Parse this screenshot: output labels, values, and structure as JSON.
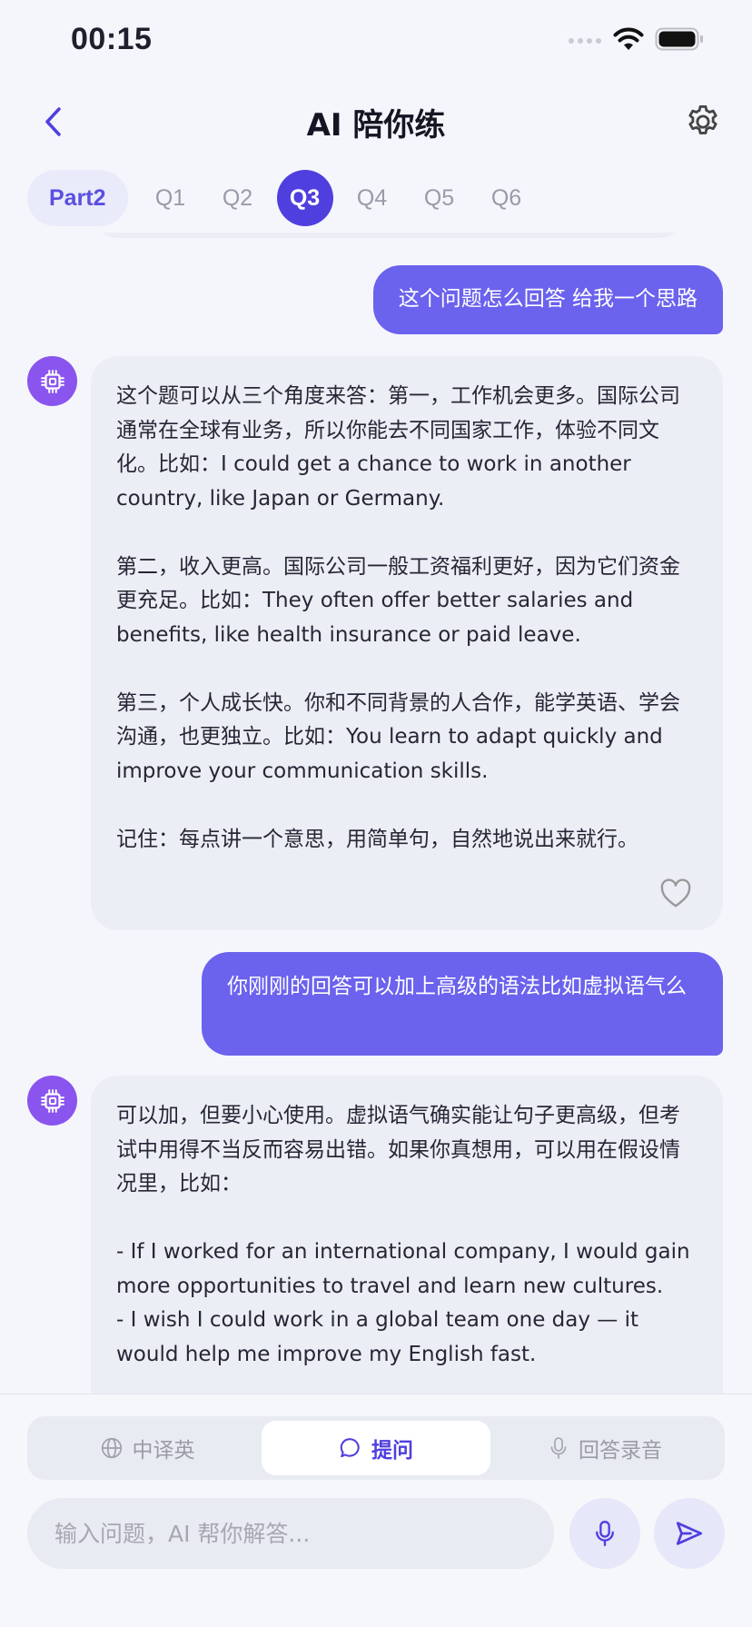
{
  "status_bar": {
    "time": "00:15"
  },
  "header": {
    "title": "AI 陪你练"
  },
  "tabs": {
    "part": "Part2",
    "questions": [
      "Q1",
      "Q2",
      "Q3",
      "Q4",
      "Q5",
      "Q6"
    ],
    "active": "Q3"
  },
  "chat": {
    "user_msg_1": "这个问题怎么回答 给我一个思路",
    "ai_msg_1": [
      "这个题可以从三个角度来答：第一，工作机会更多。国际公司通常在全球有业务，所以你能去不同国家工作，体验不同文化。比如：I could get a chance to work in another country, like Japan or Germany.",
      "第二，收入更高。国际公司一般工资福利更好，因为它们资金更充足。比如：They often offer better salaries and benefits, like health insurance or paid leave.",
      "第三，个人成长快。你和不同背景的人合作，能学英语、学会沟通，也更独立。比如：You learn to adapt quickly and improve your communication skills.",
      "记住：每点讲一个意思，用简单句，自然地说出来就行。"
    ],
    "user_msg_2": "你刚刚的回答可以加上高级的语法比如虚拟语气么",
    "ai_msg_2": [
      "可以加，但要小心使用。虚拟语气确实能让句子更高级，但考试中用得不当反而容易出错。如果你真想用，可以用在假设情况里，比如：",
      "- If I worked for an international company, I would gain more opportunities to travel and learn new cultures.\n- I wish I could work in a global team one day — it would help me improve my English fast."
    ]
  },
  "modes": {
    "translate": "中译英",
    "ask": "提问",
    "record": "回答录音",
    "active": "ask"
  },
  "input": {
    "placeholder": "输入问题，AI 帮你解答..."
  },
  "colors": {
    "accent": "#4F3FDF",
    "user_bubble": "#6B62EE",
    "avatar": "#8A55EE"
  }
}
